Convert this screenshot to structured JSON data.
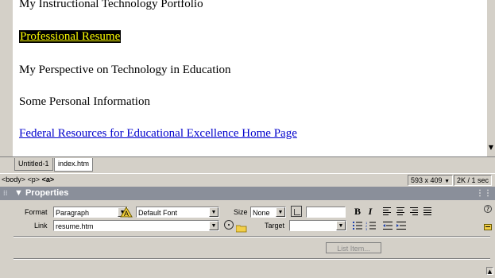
{
  "document": {
    "lines": [
      "My Instructional Technology Portfolio",
      "Professional Resume",
      "My Perspective on Technology in Education",
      "Some Personal Information",
      "Federal Resources for Educational Excellence Home Page"
    ]
  },
  "tabs": [
    "Untitled-1",
    "index.htm"
  ],
  "status": {
    "tag_body": "<body>",
    "tag_p": "<p>",
    "tag_a": "<a>",
    "window_size": "593 x 409",
    "download": "2K / 1 sec"
  },
  "properties": {
    "title": "Properties",
    "format_label": "Format",
    "format_value": "Paragraph",
    "font_value": "Default Font",
    "size_label": "Size",
    "size_value": "None",
    "link_label": "Link",
    "link_value": "resume.htm",
    "target_label": "Target",
    "target_value": "",
    "bold": "B",
    "italic": "I",
    "list_item_button": "List Item..."
  }
}
